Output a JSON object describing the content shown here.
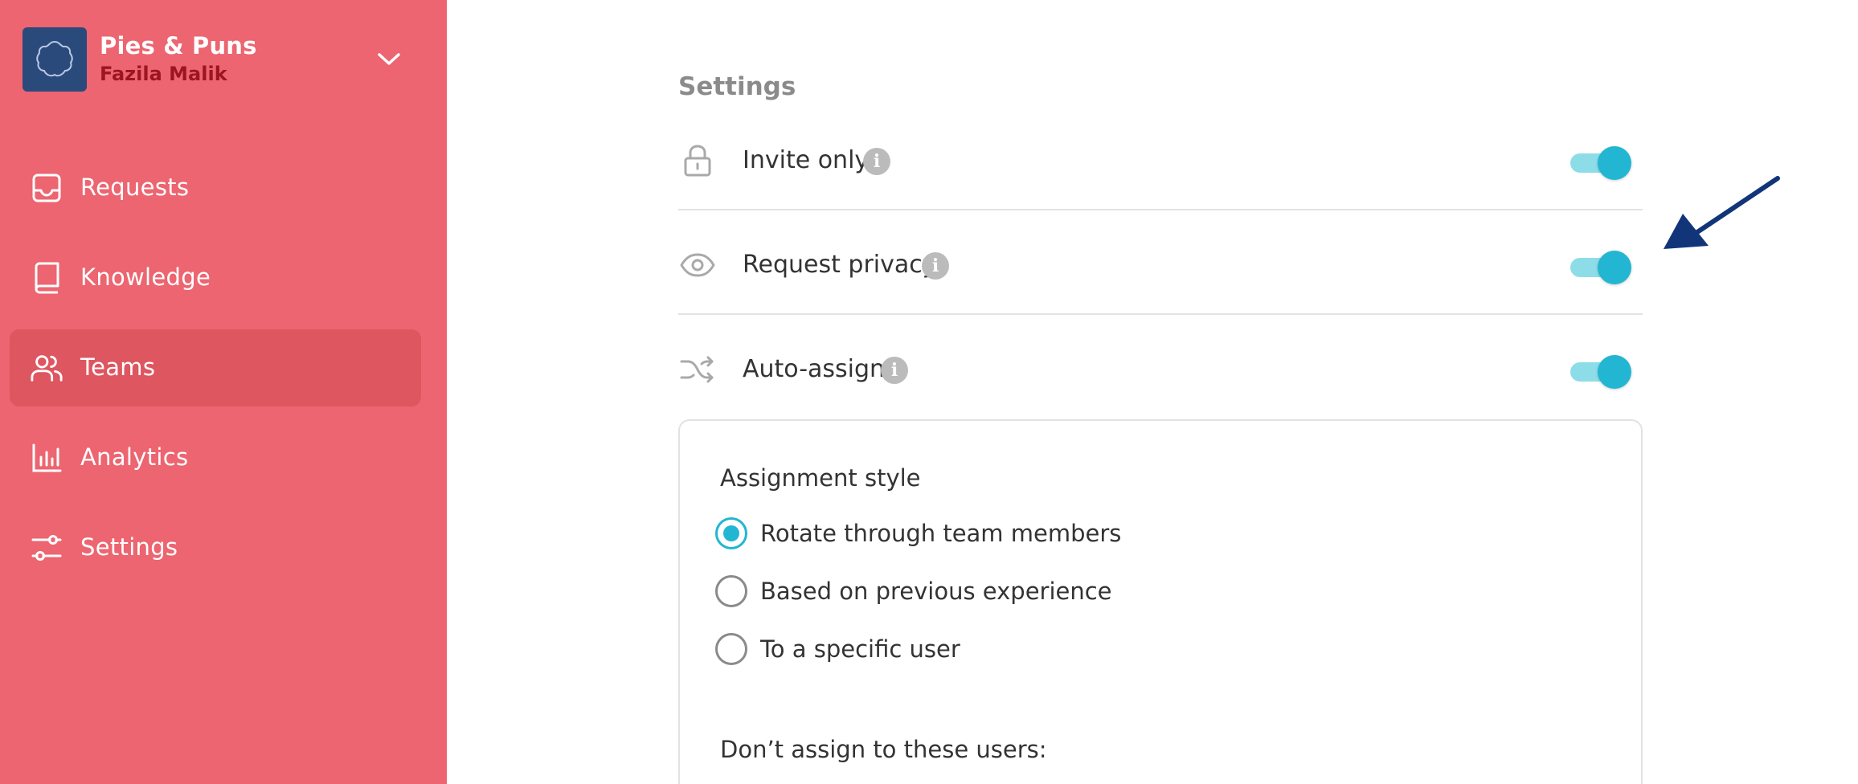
{
  "org": {
    "name": "Pies & Puns",
    "user": "Fazila Malik"
  },
  "nav": {
    "items": [
      {
        "label": "Requests",
        "icon": "inbox-icon"
      },
      {
        "label": "Knowledge",
        "icon": "book-icon"
      },
      {
        "label": "Teams",
        "icon": "users-icon",
        "active": true
      },
      {
        "label": "Analytics",
        "icon": "bar-chart-icon"
      },
      {
        "label": "Settings",
        "icon": "sliders-icon"
      }
    ]
  },
  "settings": {
    "title": "Settings",
    "rows": [
      {
        "label": "Invite only",
        "icon": "lock-icon",
        "enabled": true
      },
      {
        "label": "Request privacy",
        "icon": "eye-icon",
        "enabled": true
      },
      {
        "label": "Auto-assign",
        "icon": "shuffle-icon",
        "enabled": true
      }
    ],
    "info_glyph": "i"
  },
  "assignment": {
    "heading": "Assignment style",
    "options": [
      {
        "label": "Rotate through team members",
        "selected": true
      },
      {
        "label": "Based on previous experience",
        "selected": false
      },
      {
        "label": "To a specific user",
        "selected": false
      }
    ],
    "exclude_label": "Don’t assign to these users:"
  },
  "colors": {
    "sidebar_bg": "#ec6570",
    "sidebar_active": "#de5660",
    "org_logo": "#2b4a7c",
    "org_user": "#9c1622",
    "accent": "#22b6d2",
    "toggle_track": "#8ddde8",
    "arrow": "#12357a"
  }
}
